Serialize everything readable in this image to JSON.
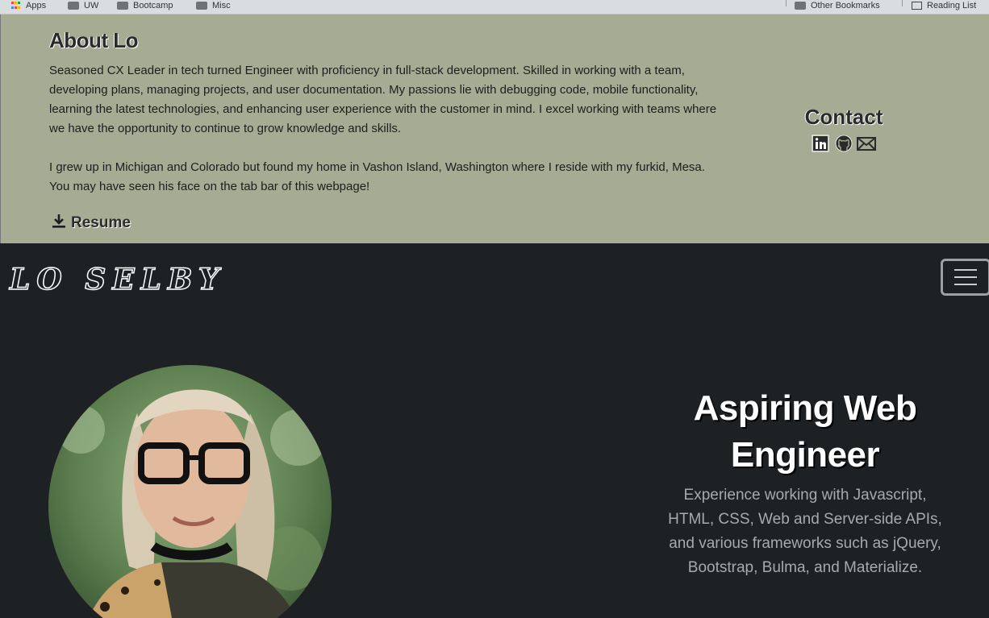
{
  "bookmarks": {
    "apps": "Apps",
    "uw": "UW",
    "bootcamp": "Bootcamp",
    "misc": "Misc",
    "other": "Other Bookmarks",
    "reading_list": "Reading List"
  },
  "about": {
    "title": "About Lo",
    "paragraph1": "Seasoned CX Leader in tech turned Engineer with proficiency in full-stack development. Skilled in working with a team, developing plans, managing projects, and user documentation. My passions lie with debugging code, mobile functionality, learning the latest technologies, and enhancing user experience with the customer in mind. I excel working with teams where we have the opportunity to continue to grow knowledge and skills.",
    "paragraph2": "I grew up in Michigan and Colorado but found my home in Vashon Island, Washington where I reside with my furkid, Mesa. You may have seen his face on the tab bar of this webpage!",
    "resume_label": "Resume"
  },
  "contact": {
    "title": "Contact",
    "icons": [
      "linkedin-icon",
      "github-icon",
      "email-icon"
    ]
  },
  "navbar": {
    "brand": "LO SELBY"
  },
  "hero": {
    "title": "Aspiring Web Engineer",
    "description": "Experience working with Javascript, HTML, CSS, Web and Server-side APIs, and various frameworks such as jQuery, Bootstrap, Bulma, and Materialize."
  },
  "colors": {
    "about_bg": "#a6ab93",
    "page_bg": "#1d2124",
    "hero_text": "#a5aaae"
  }
}
